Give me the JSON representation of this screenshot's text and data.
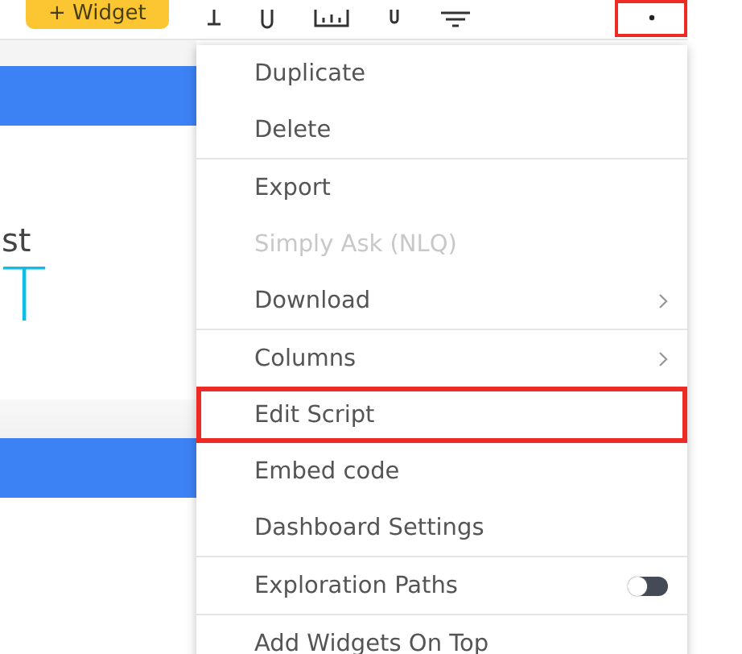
{
  "toolbar": {
    "add_button": "+ Widget",
    "highlighted_more": true
  },
  "panel": {
    "caption": "st",
    "value": "T"
  },
  "menu": {
    "items": [
      {
        "label": "Duplicate",
        "kind": "plain",
        "disabled": false,
        "highlighted": false
      },
      {
        "label": "Delete",
        "kind": "plain",
        "disabled": false,
        "highlighted": false,
        "divider_after": true
      },
      {
        "label": "Export",
        "kind": "plain",
        "disabled": false,
        "highlighted": false
      },
      {
        "label": "Simply Ask (NLQ)",
        "kind": "plain",
        "disabled": true,
        "highlighted": false
      },
      {
        "label": "Download",
        "kind": "submenu",
        "disabled": false,
        "highlighted": false,
        "divider_after": true
      },
      {
        "label": "Columns",
        "kind": "submenu",
        "disabled": false,
        "highlighted": false
      },
      {
        "label": "Edit Script",
        "kind": "plain",
        "disabled": false,
        "highlighted": true
      },
      {
        "label": "Embed code",
        "kind": "plain",
        "disabled": false,
        "highlighted": false
      },
      {
        "label": "Dashboard Settings",
        "kind": "plain",
        "disabled": false,
        "highlighted": false,
        "divider_after": true
      },
      {
        "label": "Exploration Paths",
        "kind": "toggle",
        "on": false,
        "disabled": false,
        "highlighted": false,
        "divider_after": true
      },
      {
        "label": "Add Widgets On Top",
        "kind": "plain",
        "disabled": false,
        "highlighted": false
      }
    ]
  }
}
